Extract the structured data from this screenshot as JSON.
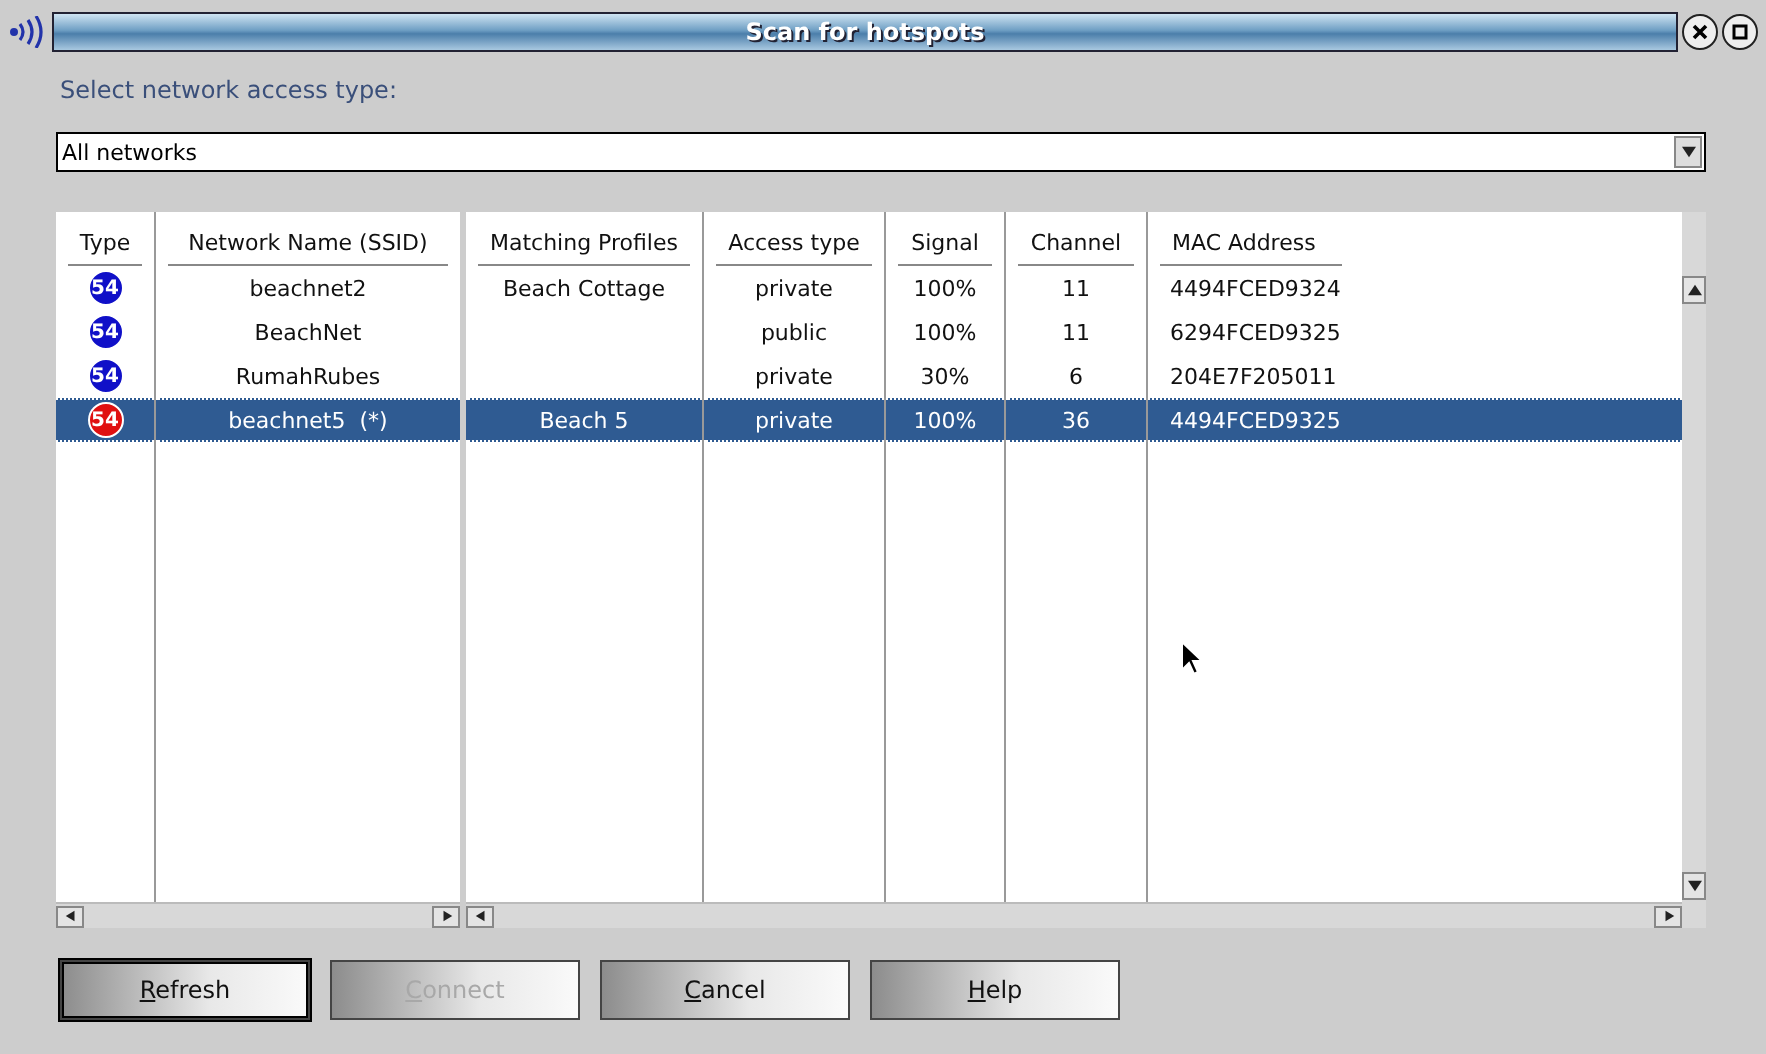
{
  "window": {
    "title": "Scan for hotspots"
  },
  "access_type": {
    "label": "Select network access type:",
    "value": "All networks"
  },
  "table": {
    "left_columns": [
      "Type",
      "Network Name (SSID)"
    ],
    "right_columns": [
      "Matching Profiles",
      "Access type",
      "Signal",
      "Channel",
      "MAC Address"
    ],
    "rows": [
      {
        "type": "54",
        "color": "#1010c8",
        "ssid": "beachnet2",
        "profile": "Beach Cottage",
        "access": "private",
        "signal": "100%",
        "channel": "11",
        "mac": "4494FCED9324",
        "selected": false
      },
      {
        "type": "54",
        "color": "#1010c8",
        "ssid": "BeachNet",
        "profile": "",
        "access": "public",
        "signal": "100%",
        "channel": "11",
        "mac": "6294FCED9325",
        "selected": false
      },
      {
        "type": "54",
        "color": "#1010c8",
        "ssid": "RumahRubes",
        "profile": "",
        "access": "private",
        "signal": "30%",
        "channel": "6",
        "mac": "204E7F205011",
        "selected": false
      },
      {
        "type": "54",
        "color": "#e01010",
        "ssid": "beachnet5  (*)",
        "profile": "Beach 5",
        "access": "private",
        "signal": "100%",
        "channel": "36",
        "mac": "4494FCED9325",
        "selected": true
      }
    ]
  },
  "buttons": [
    {
      "label": "Refresh",
      "disabled": false,
      "default": true
    },
    {
      "label": "Connect",
      "disabled": true,
      "default": false
    },
    {
      "label": "Cancel",
      "disabled": false,
      "default": false
    },
    {
      "label": "Help",
      "disabled": false,
      "default": false
    }
  ]
}
